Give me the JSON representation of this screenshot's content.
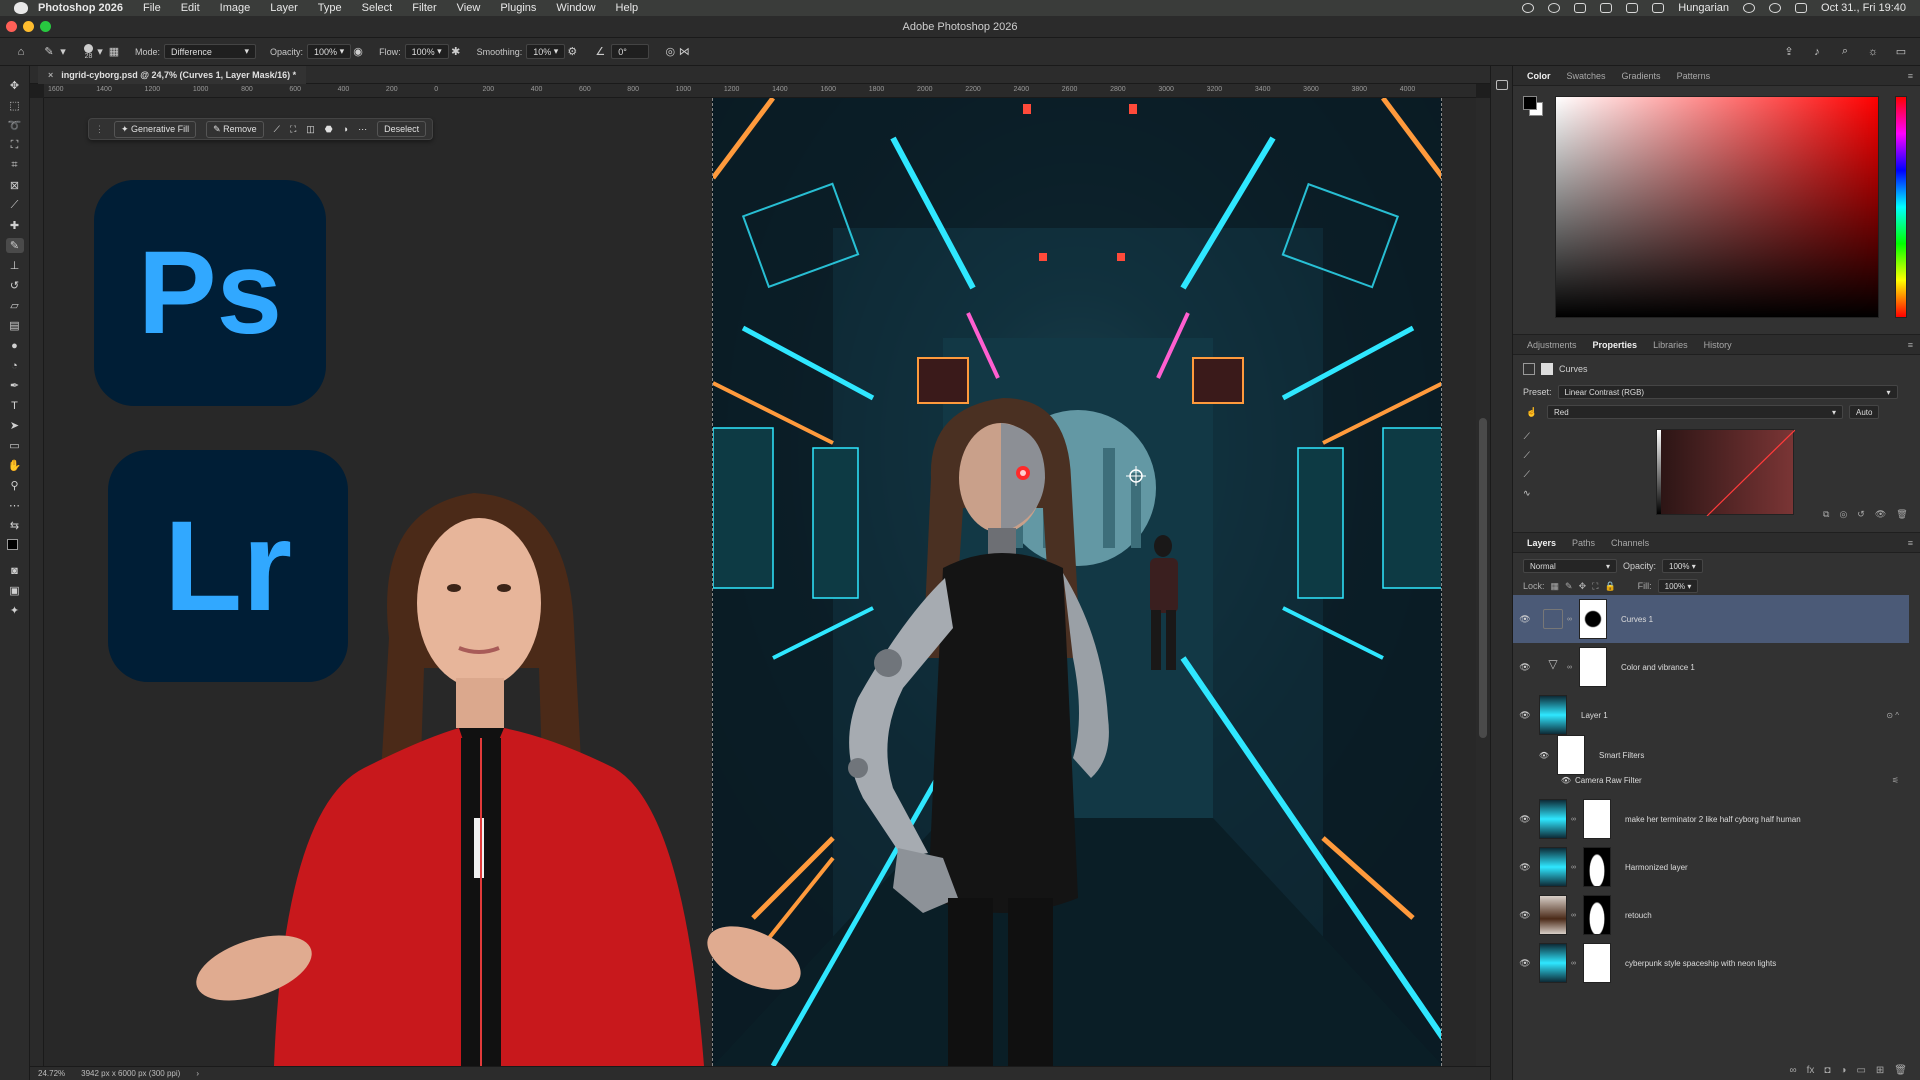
{
  "menubar": {
    "app_name": "Photoshop 2026",
    "items": [
      "File",
      "Edit",
      "Image",
      "Layer",
      "Type",
      "Select",
      "Filter",
      "View",
      "Plugins",
      "Window",
      "Help"
    ],
    "input_source": "Hungarian",
    "datetime": "Oct 31., Fri 19:40"
  },
  "titlebar": {
    "title": "Adobe Photoshop 2026"
  },
  "options": {
    "brush_size": "28",
    "mode_label": "Mode:",
    "mode_value": "Difference",
    "opacity_label": "Opacity:",
    "opacity_value": "100%",
    "flow_label": "Flow:",
    "flow_value": "100%",
    "smoothing_label": "Smoothing:",
    "smoothing_value": "10%",
    "angle_value": "0°"
  },
  "document": {
    "tab_title": "ingrid-cyborg.psd @ 24,7% (Curves 1, Layer Mask/16) *",
    "zoom": "24.72%",
    "doc_info": "3942 px x 6000 px (300 ppi)",
    "ruler_ticks": [
      "1600",
      "1400",
      "1200",
      "1000",
      "800",
      "600",
      "400",
      "200",
      "0",
      "200",
      "400",
      "600",
      "800",
      "1000",
      "1200",
      "1400",
      "1600",
      "1800",
      "2000",
      "2200",
      "2400",
      "2600",
      "2800",
      "3000",
      "3200",
      "3400",
      "3600",
      "3800",
      "4000"
    ]
  },
  "taskbar": {
    "generative_fill": "Generative Fill",
    "remove": "Remove",
    "deselect": "Deselect"
  },
  "logos": {
    "ps": "Ps",
    "lr": "Lr"
  },
  "color_panel": {
    "tabs": [
      "Color",
      "Swatches",
      "Gradients",
      "Patterns"
    ],
    "active_tab": "Color"
  },
  "properties_panel": {
    "tabs": [
      "Adjustments",
      "Properties",
      "Libraries",
      "History"
    ],
    "active_tab": "Properties",
    "adjustment_name": "Curves",
    "preset_label": "Preset:",
    "preset_value": "Linear Contrast (RGB)",
    "channel_value": "Red",
    "auto_label": "Auto"
  },
  "layers_panel": {
    "tabs": [
      "Layers",
      "Paths",
      "Channels"
    ],
    "active_tab": "Layers",
    "blend_mode": "Normal",
    "opacity_label": "Opacity:",
    "opacity_value": "100%",
    "lock_label": "Lock:",
    "fill_label": "Fill:",
    "fill_value": "100%",
    "layers": [
      {
        "name": "Curves 1",
        "type": "adjustment",
        "selected": true
      },
      {
        "name": "Color and vibrance 1",
        "type": "adjustment",
        "selected": false
      },
      {
        "name": "Layer 1",
        "type": "smart-object",
        "selected": false
      },
      {
        "name": "Smart Filters",
        "type": "smart-filters",
        "selected": false
      },
      {
        "name": "Camera Raw Filter",
        "type": "filter",
        "selected": false
      },
      {
        "name": "make her terminator 2 like half cyborg half human",
        "type": "generative",
        "selected": false
      },
      {
        "name": "Harmonized layer",
        "type": "generative",
        "selected": false
      },
      {
        "name": "retouch",
        "type": "pixel",
        "selected": false
      },
      {
        "name": "cyberpunk style spaceship with neon lights",
        "type": "generative",
        "selected": false
      }
    ]
  },
  "colors": {
    "selection": "#4b5a77",
    "ps_blue": "#31a8ff",
    "logo_bg": "#001e36",
    "neon_cyan": "#2fe7ff",
    "neon_orange": "#ff9a3c",
    "jacket_red": "#c8181c"
  }
}
